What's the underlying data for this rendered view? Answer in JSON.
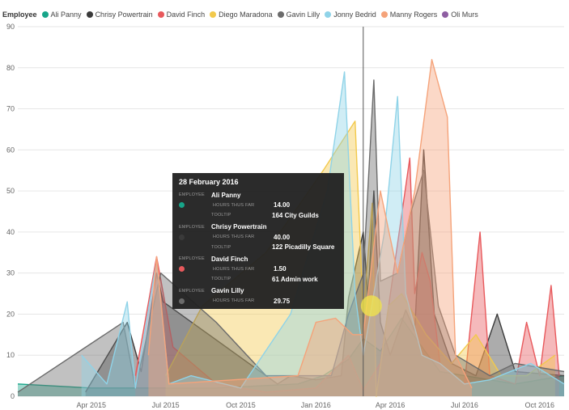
{
  "legend": {
    "title": "Employee"
  },
  "tooltip": {
    "date": "28 February 2016",
    "labels": {
      "employee": "EMPLOYEE",
      "hours": "HOURS THUS FAR",
      "tooltip": "TOOLTIP"
    },
    "entries": [
      {
        "employee": "Ali Panny",
        "hours": "14.00",
        "tooltip": "164 City Guilds",
        "color": "#17a589"
      },
      {
        "employee": "Chrisy Powertrain",
        "hours": "40.00",
        "tooltip": "122 Picadilly Square",
        "color": "#3a3a3a"
      },
      {
        "employee": "David Finch",
        "hours": "1.50",
        "tooltip": "61 Admin work",
        "color": "#e8595c"
      },
      {
        "employee": "Gavin Lilly",
        "hours": "29.75",
        "tooltip": "",
        "color": "#6b6b6b"
      }
    ]
  },
  "chart_data": {
    "type": "area",
    "ylim": [
      0,
      90
    ],
    "yticks": [
      0,
      10,
      20,
      30,
      40,
      50,
      60,
      70,
      80,
      90
    ],
    "xlim": [
      "2015-01-01",
      "2016-10-31"
    ],
    "xticks": [
      {
        "date": "2015-04-01",
        "label": "Apr 2015"
      },
      {
        "date": "2015-07-01",
        "label": "Jul 2015"
      },
      {
        "date": "2015-10-01",
        "label": "Oct 2015"
      },
      {
        "date": "2016-01-01",
        "label": "Jan 2016"
      },
      {
        "date": "2016-04-01",
        "label": "Apr 2016"
      },
      {
        "date": "2016-07-01",
        "label": "Jul 2016"
      },
      {
        "date": "2016-10-01",
        "label": "Oct 2016"
      }
    ],
    "grid": true,
    "legend": "top-left",
    "hover_date": "2016-02-28",
    "series": [
      {
        "name": "Ali Panny",
        "color": "#17a589",
        "points": [
          [
            "2015-01-01",
            3
          ],
          [
            "2015-04-01",
            2
          ],
          [
            "2015-06-10",
            2
          ],
          [
            "2015-09-01",
            2
          ],
          [
            "2015-12-10",
            3
          ],
          [
            "2016-01-10",
            5
          ],
          [
            "2016-02-10",
            9
          ],
          [
            "2016-02-28",
            14
          ],
          [
            "2016-03-20",
            11
          ],
          [
            "2016-04-15",
            19
          ],
          [
            "2016-05-10",
            12
          ],
          [
            "2016-06-01",
            6
          ],
          [
            "2016-07-01",
            5
          ],
          [
            "2016-08-01",
            4
          ],
          [
            "2016-09-01",
            3
          ],
          [
            "2016-10-01",
            4
          ],
          [
            "2016-10-31",
            5
          ]
        ]
      },
      {
        "name": "Chrisy Powertrain",
        "color": "#3a3a3a",
        "points": [
          [
            "2015-03-25",
            1
          ],
          [
            "2015-05-15",
            18
          ],
          [
            "2015-06-01",
            6
          ],
          [
            "2015-06-20",
            30
          ],
          [
            "2015-06-28",
            23
          ],
          [
            "2015-11-15",
            3
          ],
          [
            "2015-12-01",
            5
          ],
          [
            "2016-01-01",
            4
          ],
          [
            "2016-02-01",
            5
          ],
          [
            "2016-02-10",
            24
          ],
          [
            "2016-02-28",
            40
          ],
          [
            "2016-03-05",
            24
          ],
          [
            "2016-03-12",
            50
          ],
          [
            "2016-03-20",
            18
          ],
          [
            "2016-04-01",
            10
          ],
          [
            "2016-04-20",
            21
          ],
          [
            "2016-05-01",
            16
          ],
          [
            "2016-05-12",
            60
          ],
          [
            "2016-05-25",
            20
          ],
          [
            "2016-06-15",
            8
          ],
          [
            "2016-07-15",
            5
          ],
          [
            "2016-08-10",
            20
          ],
          [
            "2016-09-01",
            6
          ],
          [
            "2016-10-31",
            5
          ]
        ]
      },
      {
        "name": "David Finch",
        "color": "#e8595c",
        "points": [
          [
            "2015-05-25",
            5
          ],
          [
            "2015-06-20",
            34
          ],
          [
            "2015-07-10",
            12
          ],
          [
            "2015-09-01",
            3
          ],
          [
            "2015-11-01",
            1
          ],
          [
            "2016-01-01",
            2
          ],
          [
            "2016-02-10",
            10
          ],
          [
            "2016-02-28",
            1.5
          ],
          [
            "2016-03-20",
            8
          ],
          [
            "2016-04-25",
            58
          ],
          [
            "2016-05-01",
            25
          ],
          [
            "2016-05-10",
            35
          ],
          [
            "2016-05-20",
            28
          ],
          [
            "2016-06-01",
            8
          ],
          [
            "2016-07-01",
            3
          ],
          [
            "2016-07-20",
            40
          ],
          [
            "2016-08-01",
            5
          ],
          [
            "2016-09-01",
            3
          ],
          [
            "2016-09-15",
            18
          ],
          [
            "2016-10-01",
            5
          ],
          [
            "2016-10-15",
            27
          ],
          [
            "2016-10-25",
            5
          ]
        ]
      },
      {
        "name": "Diego Maradona",
        "color": "#f2c94c",
        "points": [
          [
            "2015-07-01",
            5
          ],
          [
            "2015-08-15",
            22
          ],
          [
            "2015-11-01",
            35
          ],
          [
            "2016-01-10",
            55
          ],
          [
            "2016-02-18",
            67
          ],
          [
            "2016-02-28",
            20
          ],
          [
            "2016-03-10",
            47
          ],
          [
            "2016-03-15",
            0
          ],
          [
            "2016-03-30",
            22
          ],
          [
            "2016-04-15",
            25
          ],
          [
            "2016-05-15",
            15
          ],
          [
            "2016-06-15",
            8
          ],
          [
            "2016-07-15",
            15
          ],
          [
            "2016-08-15",
            5
          ],
          [
            "2016-09-15",
            5
          ],
          [
            "2016-10-20",
            10
          ]
        ]
      },
      {
        "name": "Gavin Lilly",
        "color": "#6b6b6b",
        "points": [
          [
            "2015-01-01",
            1
          ],
          [
            "2015-05-10",
            18
          ],
          [
            "2015-05-25",
            2
          ],
          [
            "2015-06-25",
            30
          ],
          [
            "2015-09-01",
            18
          ],
          [
            "2015-11-01",
            5
          ],
          [
            "2016-01-01",
            5
          ],
          [
            "2016-01-20",
            5
          ],
          [
            "2016-02-10",
            20
          ],
          [
            "2016-02-28",
            29.75
          ],
          [
            "2016-03-12",
            77
          ],
          [
            "2016-03-20",
            28
          ],
          [
            "2016-04-10",
            30
          ],
          [
            "2016-04-25",
            44
          ],
          [
            "2016-05-12",
            55
          ],
          [
            "2016-05-30",
            22
          ],
          [
            "2016-06-20",
            10
          ],
          [
            "2016-08-01",
            5
          ],
          [
            "2016-09-01",
            8
          ],
          [
            "2016-10-31",
            6
          ]
        ]
      },
      {
        "name": "Jonny Bedrid",
        "color": "#8fd3e8",
        "points": [
          [
            "2015-03-20",
            10
          ],
          [
            "2015-04-20",
            3
          ],
          [
            "2015-05-15",
            23
          ],
          [
            "2015-05-25",
            2
          ],
          [
            "2015-06-20",
            33
          ],
          [
            "2015-07-05",
            3
          ],
          [
            "2015-08-01",
            5
          ],
          [
            "2015-10-01",
            2
          ],
          [
            "2015-12-01",
            20
          ],
          [
            "2016-01-15",
            50
          ],
          [
            "2016-02-05",
            79
          ],
          [
            "2016-02-18",
            25
          ],
          [
            "2016-02-28",
            10
          ],
          [
            "2016-03-25",
            40
          ],
          [
            "2016-04-10",
            73
          ],
          [
            "2016-04-20",
            25
          ],
          [
            "2016-05-10",
            10
          ],
          [
            "2016-06-01",
            8
          ],
          [
            "2016-07-01",
            3
          ],
          [
            "2016-08-01",
            4
          ],
          [
            "2016-09-20",
            8
          ],
          [
            "2016-10-31",
            3
          ]
        ]
      },
      {
        "name": "Manny Rogers",
        "color": "#f5a37a",
        "points": [
          [
            "2015-06-10",
            10
          ],
          [
            "2015-06-20",
            34
          ],
          [
            "2015-07-05",
            3
          ],
          [
            "2015-12-10",
            5
          ],
          [
            "2016-01-01",
            18
          ],
          [
            "2016-01-25",
            19
          ],
          [
            "2016-02-15",
            15
          ],
          [
            "2016-02-28",
            15
          ],
          [
            "2016-03-20",
            50
          ],
          [
            "2016-04-10",
            30
          ],
          [
            "2016-05-01",
            50
          ],
          [
            "2016-05-22",
            82
          ],
          [
            "2016-06-10",
            68
          ],
          [
            "2016-06-20",
            10
          ],
          [
            "2016-07-10",
            2
          ]
        ]
      },
      {
        "name": "Oli Murs",
        "color": "#8e5ea2",
        "points": []
      }
    ]
  }
}
